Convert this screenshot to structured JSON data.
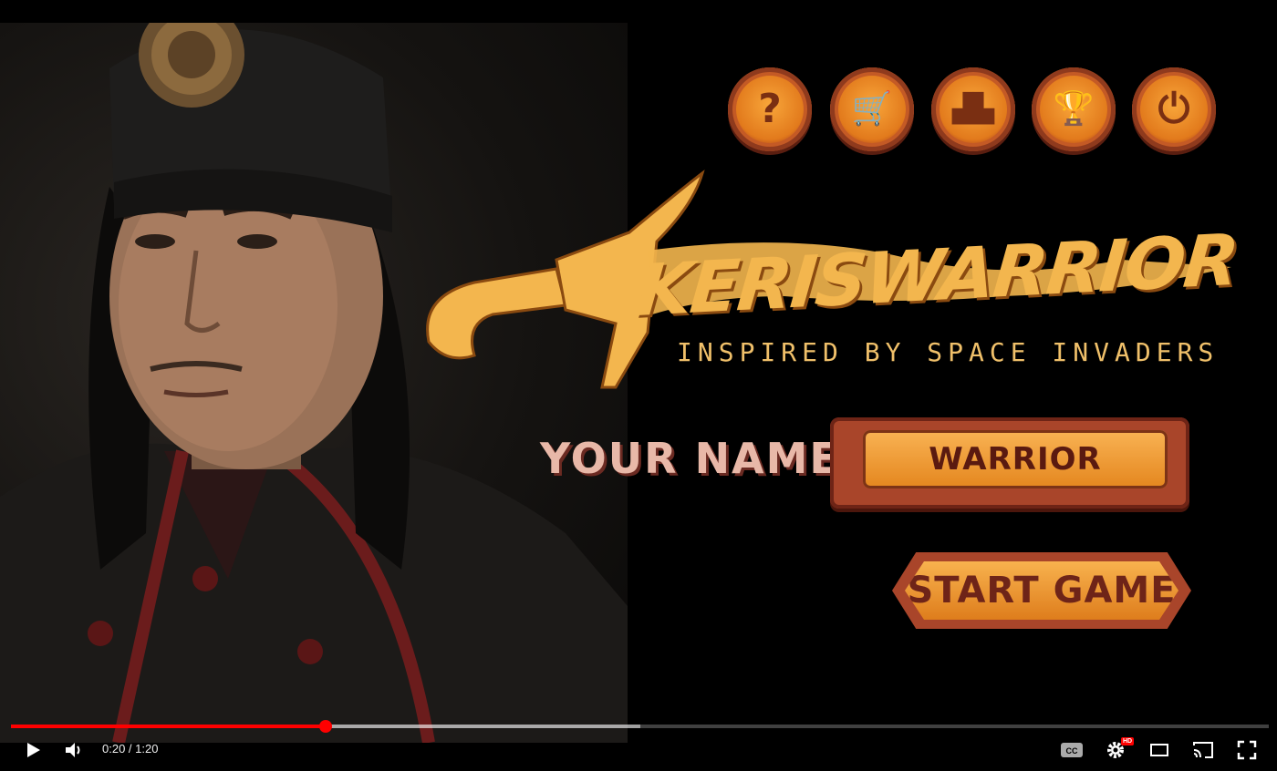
{
  "menu": {
    "buttons": [
      {
        "name": "help-button",
        "icon": "question-icon",
        "glyph": "?"
      },
      {
        "name": "shop-button",
        "icon": "cart-icon",
        "glyph": "🛒"
      },
      {
        "name": "leaderboard-button",
        "icon": "podium-icon",
        "glyph": "▟▙"
      },
      {
        "name": "achievements-button",
        "icon": "trophy-icon",
        "glyph": "🏆"
      },
      {
        "name": "power-button",
        "icon": "power-icon",
        "glyph": "⏻"
      }
    ]
  },
  "logo": {
    "title": "KERISWARRIOR",
    "subtitle": "INSPIRED BY SPACE INVADERS"
  },
  "name_field": {
    "label": "YOUR NAME:",
    "value": "WARRIOR"
  },
  "start_button": {
    "label": "START GAME"
  },
  "player": {
    "current_time": "0:20",
    "duration": "1:20",
    "time_display": "0:20 / 1:20",
    "played_fraction": 0.25,
    "buffered_fraction": 0.5,
    "hd_badge": "HD"
  },
  "colors": {
    "accent_orange": "#e27a1c",
    "logo_gold": "#f3b64e",
    "progress_red": "#ff0000"
  }
}
